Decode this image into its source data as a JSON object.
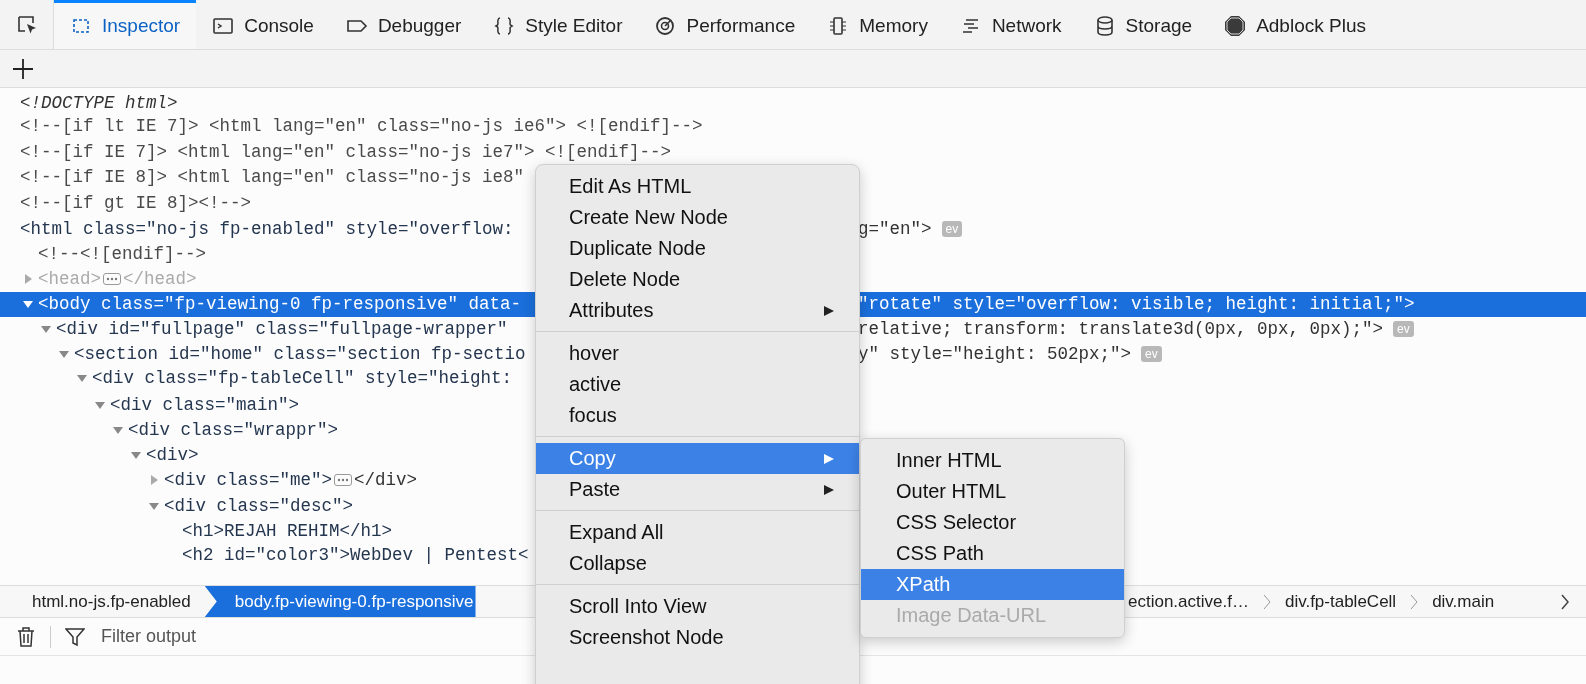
{
  "tabs": [
    {
      "label": "Inspector",
      "selected": true
    },
    {
      "label": "Console",
      "selected": false
    },
    {
      "label": "Debugger",
      "selected": false
    },
    {
      "label": "Style Editor",
      "selected": false
    },
    {
      "label": "Performance",
      "selected": false
    },
    {
      "label": "Memory",
      "selected": false
    },
    {
      "label": "Network",
      "selected": false
    },
    {
      "label": "Storage",
      "selected": false
    },
    {
      "label": "Adblock Plus",
      "selected": false
    }
  ],
  "markup": {
    "nodes": [
      {
        "kind": "doctype",
        "text": "<!DOCTYPE html>",
        "selected": false
      },
      {
        "kind": "comment",
        "text": "<!--[if lt IE 7]> <html lang=\"en\" class=\"no-js ie6\"> <![endif]-->",
        "selected": false
      },
      {
        "kind": "comment",
        "text": "<!--[if IE 7]> <html lang=\"en\" class=\"no-js ie7\"> <![endif]-->",
        "selected": false
      },
      {
        "kind": "comment",
        "text": "<!--[if IE 8]> <html lang=\"en\" class=\"no-js ie8\"",
        "selected": false
      },
      {
        "kind": "comment",
        "text": "<!--[if gt IE 8]><!-->",
        "selected": false
      },
      {
        "kind": "element",
        "text": "<html class=\"no-js fp-enabled\" style=\"overflow:",
        "text_after_menu": "g=\"en\">",
        "badge": "ev",
        "selected": false,
        "children": [
          {
            "kind": "comment",
            "text": "<!--<![endif]-->",
            "selected": false
          },
          {
            "kind": "element",
            "text": "<head>",
            "closing": "</head>",
            "expanded": false,
            "dimmed": true,
            "selected": false
          },
          {
            "kind": "element",
            "text": "<body class=\"fp-viewing-0 fp-responsive\" data-",
            "text_after_menu": "\"rotate\" style=\"overflow: visible; height: initial;\">",
            "expanded": true,
            "selected": true,
            "children": [
              {
                "kind": "element",
                "text": "<div id=\"fullpage\" class=\"fullpage-wrapper\"",
                "text_after_menu": "relative; transform: translate3d(0px, 0px, 0px);\">",
                "badge": "ev",
                "expanded": true,
                "selected": false,
                "children": [
                  {
                    "kind": "element",
                    "text": "<section id=\"home\" class=\"section fp-sectio",
                    "text_after_menu": "y\" style=\"height: 502px;\">",
                    "badge": "ev",
                    "expanded": true,
                    "selected": false,
                    "children": [
                      {
                        "kind": "element",
                        "text": "<div class=\"fp-tableCell\" style=\"height:",
                        "expanded": true,
                        "selected": false,
                        "children": [
                          {
                            "kind": "element",
                            "text": "<div class=\"main\">",
                            "expanded": true,
                            "selected": false,
                            "children": [
                              {
                                "kind": "element",
                                "text": "<div class=\"wrappr\">",
                                "expanded": true,
                                "selected": false,
                                "children": [
                                  {
                                    "kind": "element",
                                    "text": "<div>",
                                    "expanded": true,
                                    "selected": false,
                                    "children": [
                                      {
                                        "kind": "element",
                                        "text": "<div class=\"me\">",
                                        "closing": "</div>",
                                        "expanded": false,
                                        "selected": false
                                      },
                                      {
                                        "kind": "element",
                                        "text": "<div class=\"desc\">",
                                        "expanded": true,
                                        "selected": false,
                                        "children": [
                                          {
                                            "kind": "element",
                                            "text": "<h1>REJAH REHIM</h1>",
                                            "selected": false
                                          },
                                          {
                                            "kind": "element",
                                            "text": "<h2 id=\"color3\">WebDev | Pentest<",
                                            "selected": false
                                          }
                                        ]
                                      }
                                    ]
                                  }
                                ]
                              }
                            ]
                          }
                        ]
                      }
                    ]
                  }
                ]
              }
            ]
          }
        ]
      }
    ]
  },
  "breadcrumbs": {
    "before_menu": [
      {
        "label": "html.no-js.fp-enabled",
        "selected": false
      },
      {
        "label": "body.fp-viewing-0.fp-responsive",
        "selected": true
      }
    ],
    "after_menu": [
      {
        "label": "ection.active.f…",
        "selected": false
      },
      {
        "label": "div.fp-tableCell",
        "selected": false
      },
      {
        "label": "div.main",
        "selected": false
      }
    ]
  },
  "filter": {
    "placeholder": "Filter output"
  },
  "context_menu": {
    "groups": [
      [
        {
          "label": "Edit As HTML",
          "submenu": false,
          "selected": false
        },
        {
          "label": "Create New Node",
          "submenu": false,
          "selected": false
        },
        {
          "label": "Duplicate Node",
          "submenu": false,
          "selected": false
        },
        {
          "label": "Delete Node",
          "submenu": false,
          "selected": false
        },
        {
          "label": "Attributes",
          "submenu": true,
          "selected": false
        }
      ],
      [
        {
          "label": "hover",
          "submenu": false,
          "selected": false
        },
        {
          "label": "active",
          "submenu": false,
          "selected": false
        },
        {
          "label": "focus",
          "submenu": false,
          "selected": false
        }
      ],
      [
        {
          "label": "Copy",
          "submenu": true,
          "selected": true
        },
        {
          "label": "Paste",
          "submenu": true,
          "selected": false
        }
      ],
      [
        {
          "label": "Expand All",
          "submenu": false,
          "selected": false
        },
        {
          "label": "Collapse",
          "submenu": false,
          "selected": false
        }
      ],
      [
        {
          "label": "Scroll Into View",
          "submenu": false,
          "selected": false
        },
        {
          "label": "Screenshot Node",
          "submenu": false,
          "selected": false
        }
      ]
    ]
  },
  "submenu": {
    "items": [
      {
        "label": "Inner HTML",
        "selected": false,
        "disabled": false
      },
      {
        "label": "Outer HTML",
        "selected": false,
        "disabled": false
      },
      {
        "label": "CSS Selector",
        "selected": false,
        "disabled": false
      },
      {
        "label": "CSS Path",
        "selected": false,
        "disabled": false
      },
      {
        "label": "XPath",
        "selected": true,
        "disabled": false
      },
      {
        "label": "Image Data-URL",
        "selected": false,
        "disabled": true
      }
    ]
  }
}
